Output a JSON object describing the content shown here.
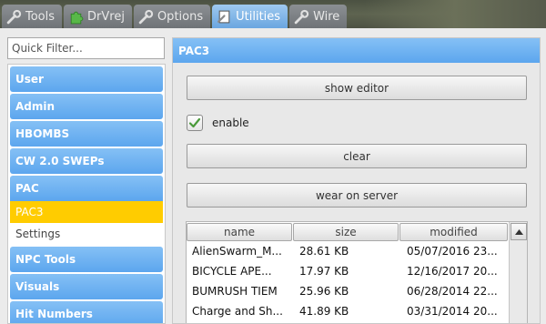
{
  "tabs": [
    {
      "label": "Tools",
      "icon": "wrench-icon"
    },
    {
      "label": "DrVrej",
      "icon": "puzzle-icon"
    },
    {
      "label": "Options",
      "icon": "wrench-icon"
    },
    {
      "label": "Utilities",
      "icon": "page-icon",
      "active": true
    },
    {
      "label": "Wire",
      "icon": "wrench-icon"
    }
  ],
  "filter": {
    "placeholder": "Quick Filter..."
  },
  "sidebar": {
    "categories": [
      "User",
      "Admin",
      "HBOMBS",
      "CW 2.0 SWEPs",
      "PAC"
    ],
    "pac_items": [
      "PAC3",
      "Settings"
    ],
    "categories_after": [
      "NPC Tools",
      "Visuals",
      "Hit Numbers"
    ]
  },
  "panel": {
    "title": "PAC3",
    "show_editor": "show editor",
    "enable_label": "enable",
    "enable_checked": true,
    "clear": "clear",
    "wear_on_server": "wear on server"
  },
  "table": {
    "columns": [
      "name",
      "size",
      "modified"
    ],
    "rows": [
      [
        "AlienSwarm_M...",
        "28.61 KB",
        "05/07/2016 23..."
      ],
      [
        "BICYCLE APE...",
        "17.97 KB",
        "12/16/2017 20..."
      ],
      [
        "BUMRUSH TIEM",
        "25.96 KB",
        "06/28/2014 22..."
      ],
      [
        "Charge and Sh...",
        "41.89 KB",
        "03/31/2014 20..."
      ]
    ]
  },
  "colors": {
    "accent_blue": "#6aa6e0",
    "selection_yellow": "#ffcc00",
    "check_green": "#4a9a3a"
  }
}
